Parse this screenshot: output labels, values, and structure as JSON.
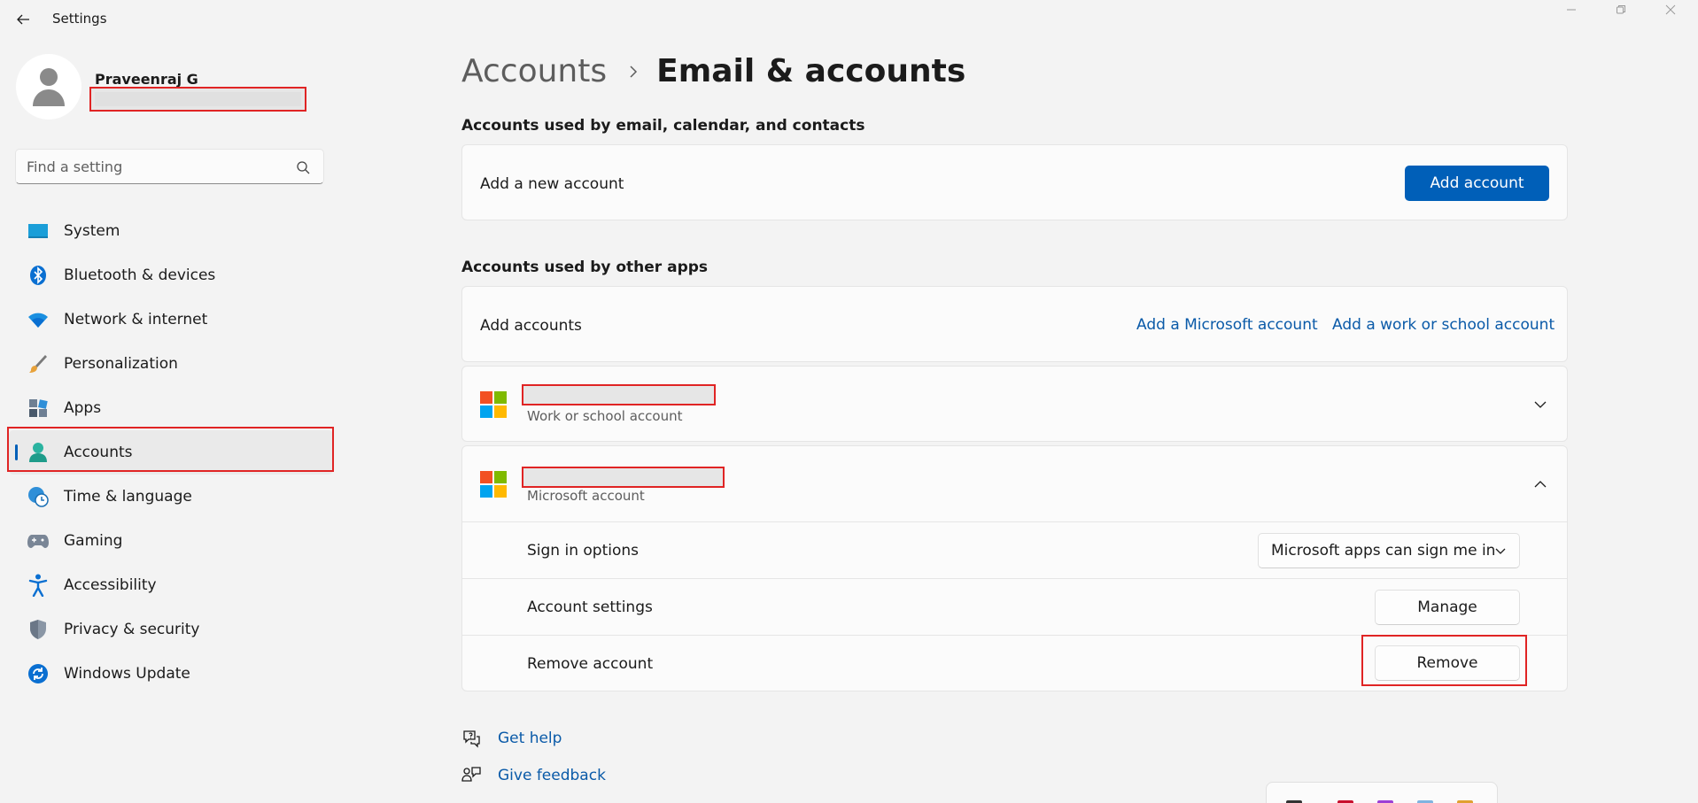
{
  "window": {
    "title": "Settings"
  },
  "profile": {
    "name": "Praveenraj G"
  },
  "search": {
    "placeholder": "Find a setting"
  },
  "nav": {
    "items": [
      {
        "label": "System",
        "icon": "system-icon"
      },
      {
        "label": "Bluetooth & devices",
        "icon": "bluetooth-icon"
      },
      {
        "label": "Network & internet",
        "icon": "wifi-icon"
      },
      {
        "label": "Personalization",
        "icon": "brush-icon"
      },
      {
        "label": "Apps",
        "icon": "apps-icon"
      },
      {
        "label": "Accounts",
        "icon": "accounts-icon",
        "active": true
      },
      {
        "label": "Time & language",
        "icon": "globe-clock-icon"
      },
      {
        "label": "Gaming",
        "icon": "gamepad-icon"
      },
      {
        "label": "Accessibility",
        "icon": "accessibility-icon"
      },
      {
        "label": "Privacy & security",
        "icon": "shield-icon"
      },
      {
        "label": "Windows Update",
        "icon": "update-icon"
      }
    ]
  },
  "breadcrumb": {
    "parent": "Accounts",
    "current": "Email & accounts"
  },
  "email_section": {
    "title": "Accounts used by email, calendar, and contacts",
    "add_label": "Add a new account",
    "add_button": "Add account"
  },
  "other_apps_section": {
    "title": "Accounts used by other apps",
    "add_label": "Add accounts",
    "add_microsoft_link": "Add a Microsoft account",
    "add_work_link": "Add a work or school account",
    "accounts": [
      {
        "type": "Work or school account",
        "expanded": false
      },
      {
        "type": "Microsoft account",
        "expanded": true
      }
    ],
    "expanded_rows": {
      "sign_in_label": "Sign in options",
      "sign_in_value": "Microsoft apps can sign me in",
      "settings_label": "Account settings",
      "settings_button": "Manage",
      "remove_label": "Remove account",
      "remove_button": "Remove"
    }
  },
  "footer": {
    "help": "Get help",
    "feedback": "Give feedback"
  },
  "colors": {
    "accent": "#005fb8",
    "highlight_outline": "#e02424",
    "link": "#0a5aa8"
  }
}
